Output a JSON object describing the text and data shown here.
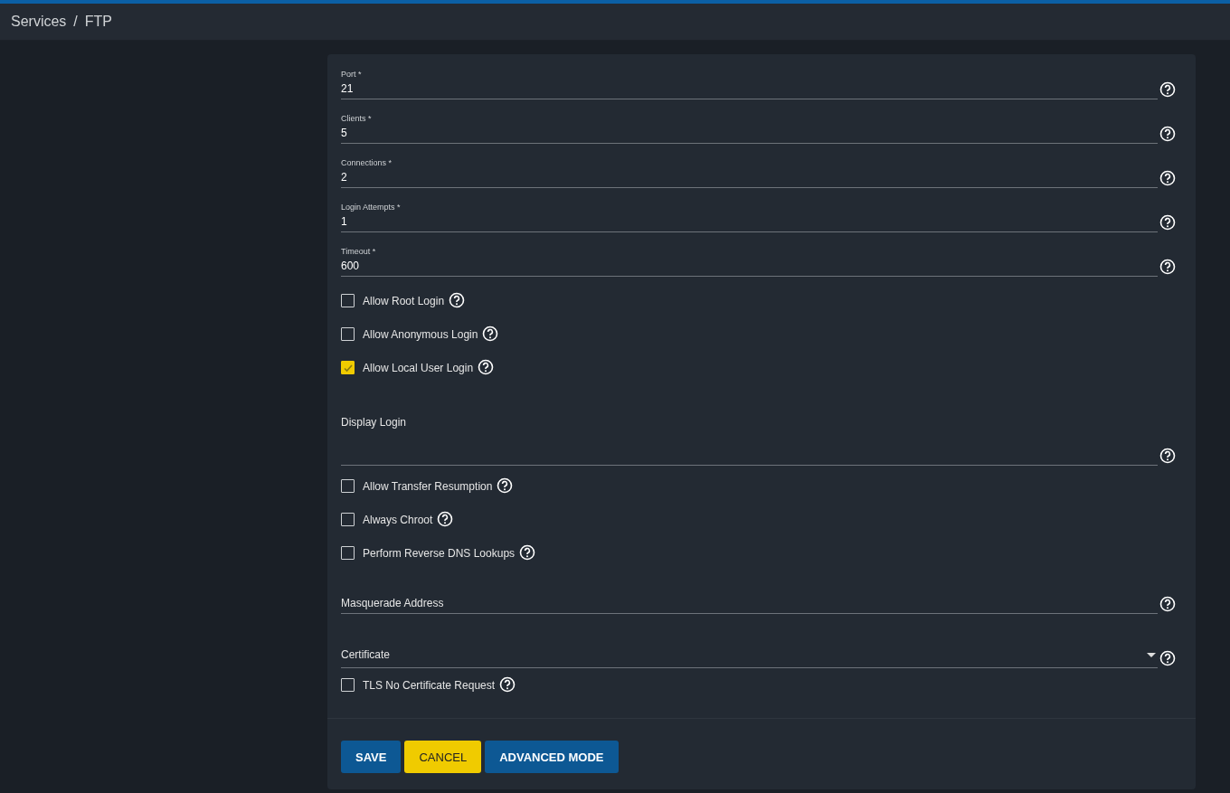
{
  "breadcrumbs": [
    {
      "label": "Services"
    },
    {
      "label": "FTP"
    }
  ],
  "breadcrumb_separator": "/",
  "fields": [
    {
      "kind": "text",
      "label": "Port *",
      "value": "21"
    },
    {
      "kind": "text",
      "label": "Clients *",
      "value": "5"
    },
    {
      "kind": "text",
      "label": "Connections *",
      "value": "2"
    },
    {
      "kind": "text",
      "label": "Login Attempts *",
      "value": "1"
    },
    {
      "kind": "text",
      "label": "Timeout *",
      "value": "600"
    },
    {
      "kind": "checkbox",
      "label": "Allow Root Login",
      "checked": false
    },
    {
      "kind": "checkbox",
      "label": "Allow Anonymous Login",
      "checked": false
    },
    {
      "kind": "checkbox",
      "label": "Allow Local User Login",
      "checked": true
    },
    {
      "kind": "textarea",
      "label": "Display Login"
    },
    {
      "kind": "checkbox",
      "label": "Allow Transfer Resumption",
      "checked": false
    },
    {
      "kind": "checkbox",
      "label": "Always Chroot",
      "checked": false
    },
    {
      "kind": "checkbox",
      "label": "Perform Reverse DNS Lookups",
      "checked": false
    },
    {
      "kind": "text",
      "label": "Masquerade Address"
    },
    {
      "kind": "select",
      "label": "Certificate"
    },
    {
      "kind": "checkbox",
      "label": "TLS No Certificate Request",
      "checked": false
    }
  ],
  "buttons": [
    {
      "label": "SAVE",
      "kind": "primary"
    },
    {
      "label": "CANCEL",
      "kind": "accent"
    },
    {
      "label": "ADVANCED MODE",
      "kind": "primary"
    }
  ]
}
